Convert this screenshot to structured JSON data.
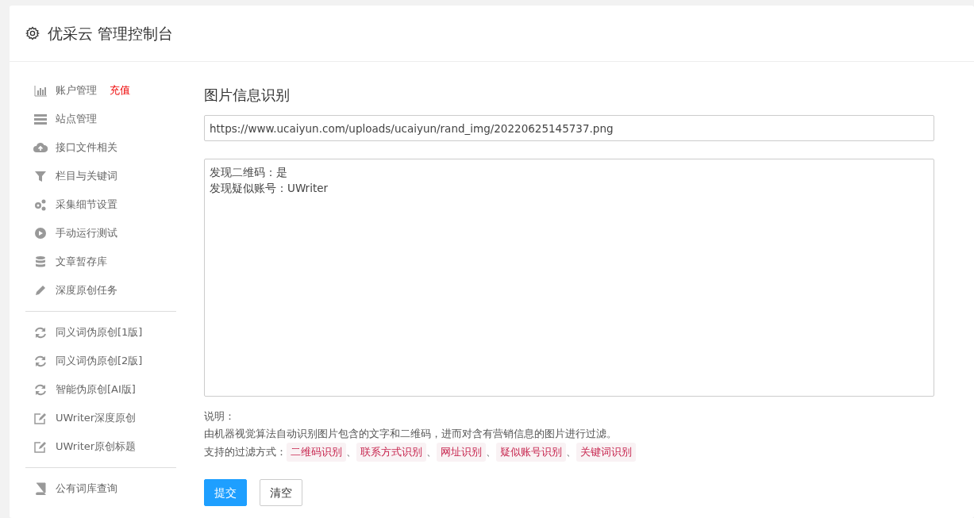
{
  "header": {
    "title": "优采云 管理控制台"
  },
  "sidebar": {
    "groups": [
      [
        {
          "label": "账户管理",
          "badge": "充值"
        },
        {
          "label": "站点管理"
        },
        {
          "label": "接口文件相关"
        },
        {
          "label": "栏目与关键词"
        },
        {
          "label": "采集细节设置"
        },
        {
          "label": "手动运行测试"
        },
        {
          "label": "文章暂存库"
        },
        {
          "label": "深度原创任务"
        }
      ],
      [
        {
          "label": "同义词伪原创[1版]"
        },
        {
          "label": "同义词伪原创[2版]"
        },
        {
          "label": "智能伪原创[AI版]"
        },
        {
          "label": "UWriter深度原创"
        },
        {
          "label": "UWriter原创标题"
        }
      ],
      [
        {
          "label": "公有词库查询"
        }
      ]
    ]
  },
  "main": {
    "title": "图片信息识别",
    "url": "https://www.ucaiyun.com/uploads/ucaiyun/rand_img/20220625145737.png",
    "result_lines": [
      "发现二维码：是",
      "发现疑似账号：UWriter"
    ],
    "notes_label": "说明：",
    "description": "由机器视觉算法自动识别图片包含的文字和二维码，进而对含有营销信息的图片进行过滤。",
    "filters_label": "支持的过滤方式：",
    "filters": [
      "二维码识别",
      "联系方式识别",
      "网址识别",
      "疑似账号识别",
      "关键词识别"
    ],
    "separator": "、",
    "buttons": [
      {
        "label": "提交",
        "kind": "primary"
      },
      {
        "label": "清空",
        "kind": "secondary"
      }
    ]
  }
}
